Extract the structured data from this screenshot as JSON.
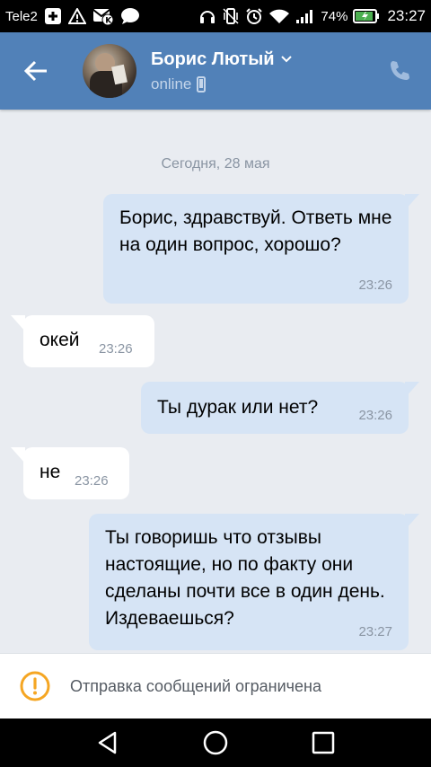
{
  "status_bar": {
    "carrier": "Tele2",
    "battery_percent": "74%",
    "time": "23:27",
    "icons": [
      "plus-box-icon",
      "warning-icon",
      "vk-mail-icon",
      "chat-bubble-icon",
      "headphones-icon",
      "vibrate-icon",
      "alarm-icon",
      "wifi-icon",
      "signal-icon",
      "battery-icon"
    ]
  },
  "header": {
    "back_icon": "arrow-left-icon",
    "contact_name": "Борис Лютый",
    "status": "online",
    "status_icon": "mobile-phone-icon",
    "call_icon": "phone-icon",
    "background_color": "#5181b8"
  },
  "chat": {
    "date_separator": "Сегодня, 28 мая",
    "messages": [
      {
        "direction": "out",
        "text": "Борис, здравствуй. Ответь мне на один вопрос, хорошо?",
        "time": "23:26"
      },
      {
        "direction": "in",
        "text": "окей",
        "time": "23:26"
      },
      {
        "direction": "out",
        "text": "Ты дурак или нет?",
        "time": "23:26"
      },
      {
        "direction": "in",
        "text": "не",
        "time": "23:26"
      },
      {
        "direction": "out",
        "text": "Ты говоришь что отзывы настоящие, но по факту они сделаны почти все в один день. Издеваешься?",
        "time": "23:27"
      }
    ],
    "outgoing_color": "#d6e4f5",
    "incoming_color": "#ffffff"
  },
  "restriction": {
    "icon": "warning-circle-icon",
    "text": "Отправка сообщений ограничена",
    "accent": "#f5a623"
  },
  "nav_bar": {
    "icons": [
      "back-triangle-icon",
      "home-circle-icon",
      "recents-square-icon"
    ]
  }
}
